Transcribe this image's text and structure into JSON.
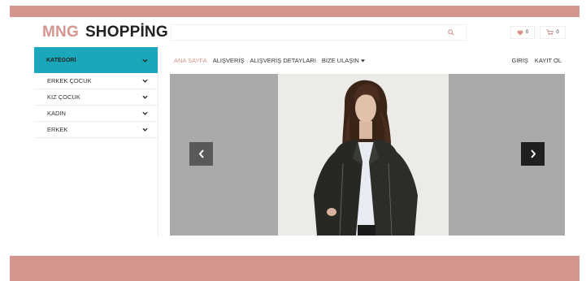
{
  "brand": {
    "mng": "MNG",
    "shopping": "SHOPPİNG"
  },
  "search": {
    "placeholder": "",
    "button_icon": "search-icon"
  },
  "header": {
    "favorites_count": "0",
    "cart_count": "0"
  },
  "nav": {
    "items": [
      {
        "label": "ANA SAYFA",
        "active": true
      },
      {
        "label": "ALIŞVERİŞ"
      },
      {
        "label": "ALIŞVERİŞ DETAYLARI"
      },
      {
        "label": "BİZE ULAŞIN",
        "dropdown": true
      }
    ],
    "right": [
      {
        "label": "GİRİŞ"
      },
      {
        "label": "KAYIT OL"
      }
    ]
  },
  "sidebar": {
    "title": "KATEGORİ",
    "items": [
      {
        "label": "ERKEK ÇOCUK"
      },
      {
        "label": "KIZ ÇOCUK"
      },
      {
        "label": "KADIN"
      },
      {
        "label": "ERKEK"
      }
    ]
  },
  "carousel": {
    "prev_icon": "chevron-left-icon",
    "next_icon": "chevron-right-icon"
  },
  "colors": {
    "brand": "#d4958e",
    "accent": "#1aa7ba",
    "carousel_bg": "#aaaaaa"
  }
}
